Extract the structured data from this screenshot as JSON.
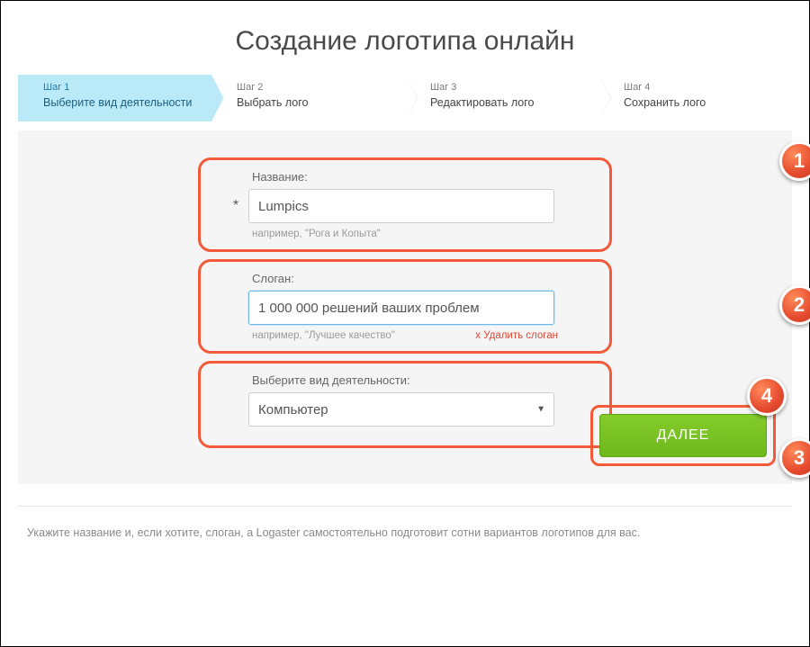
{
  "title": "Создание логотипа онлайн",
  "steps": [
    {
      "num": "Шаг 1",
      "label": "Выберите вид деятельности"
    },
    {
      "num": "Шаг 2",
      "label": "Выбрать лого"
    },
    {
      "num": "Шаг 3",
      "label": "Редактировать лого"
    },
    {
      "num": "Шаг 4",
      "label": "Сохранить лого"
    }
  ],
  "form": {
    "name_label": "Название:",
    "name_value": "Lumpics",
    "name_hint": "например, \"Рога и Копыта\"",
    "slogan_label": "Слоган:",
    "slogan_value": "1 000 000 решений ваших проблем",
    "slogan_hint": "например, \"Лучшее качество\"",
    "delete_slogan": "x Удалить слоган",
    "activity_label": "Выберите вид деятельности:",
    "activity_value": "Компьютер"
  },
  "next_button": "ДАЛЕЕ",
  "badges": {
    "b1": "1",
    "b2": "2",
    "b3": "3",
    "b4": "4"
  },
  "footer": "Укажите название и, если хотите, слоган, а Logaster самостоятельно подготовит сотни вариантов логотипов для вас."
}
